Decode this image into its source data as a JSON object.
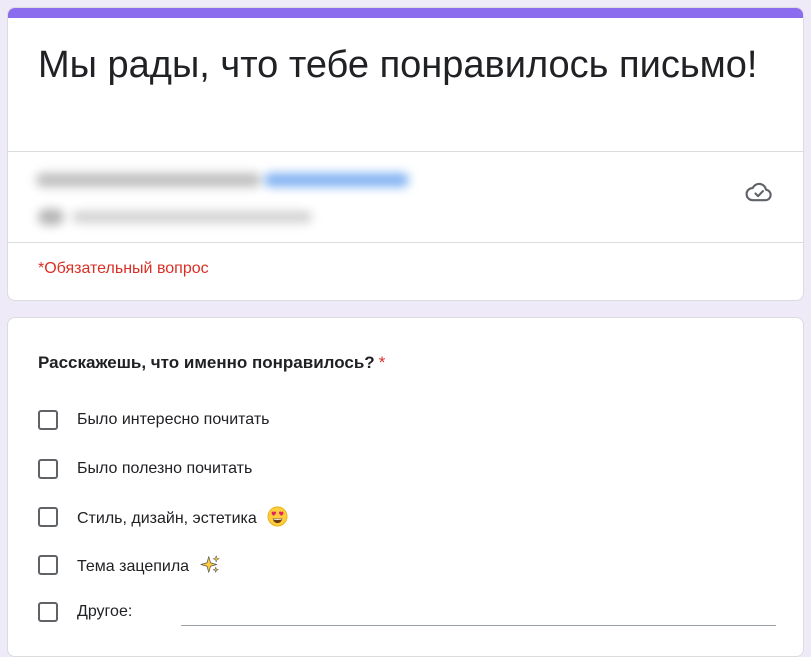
{
  "form": {
    "title": "Мы рады, что тебе понравилось письмо!",
    "required_note": "*Обязательный вопрос",
    "accent_color": "#8b6cef",
    "background_color": "#efeaf8"
  },
  "account": {
    "email_blurred": true,
    "not_shared_blurred": true,
    "cloud_icon": "cloud-check-icon"
  },
  "question": {
    "title": "Расскажешь, что именно понравилось?",
    "required_mark": "*",
    "options": [
      {
        "label": "Было интересно почитать",
        "checked": false
      },
      {
        "label": "Было полезно почитать",
        "checked": false
      },
      {
        "label": "Стиль, дизайн, эстетика",
        "checked": false,
        "icon": "heart-eyes-emoji"
      },
      {
        "label": "Тема зацепила",
        "checked": false,
        "icon": "sparkles-emoji"
      },
      {
        "label": "Другое:",
        "checked": false
      }
    ],
    "other_input_value": ""
  }
}
